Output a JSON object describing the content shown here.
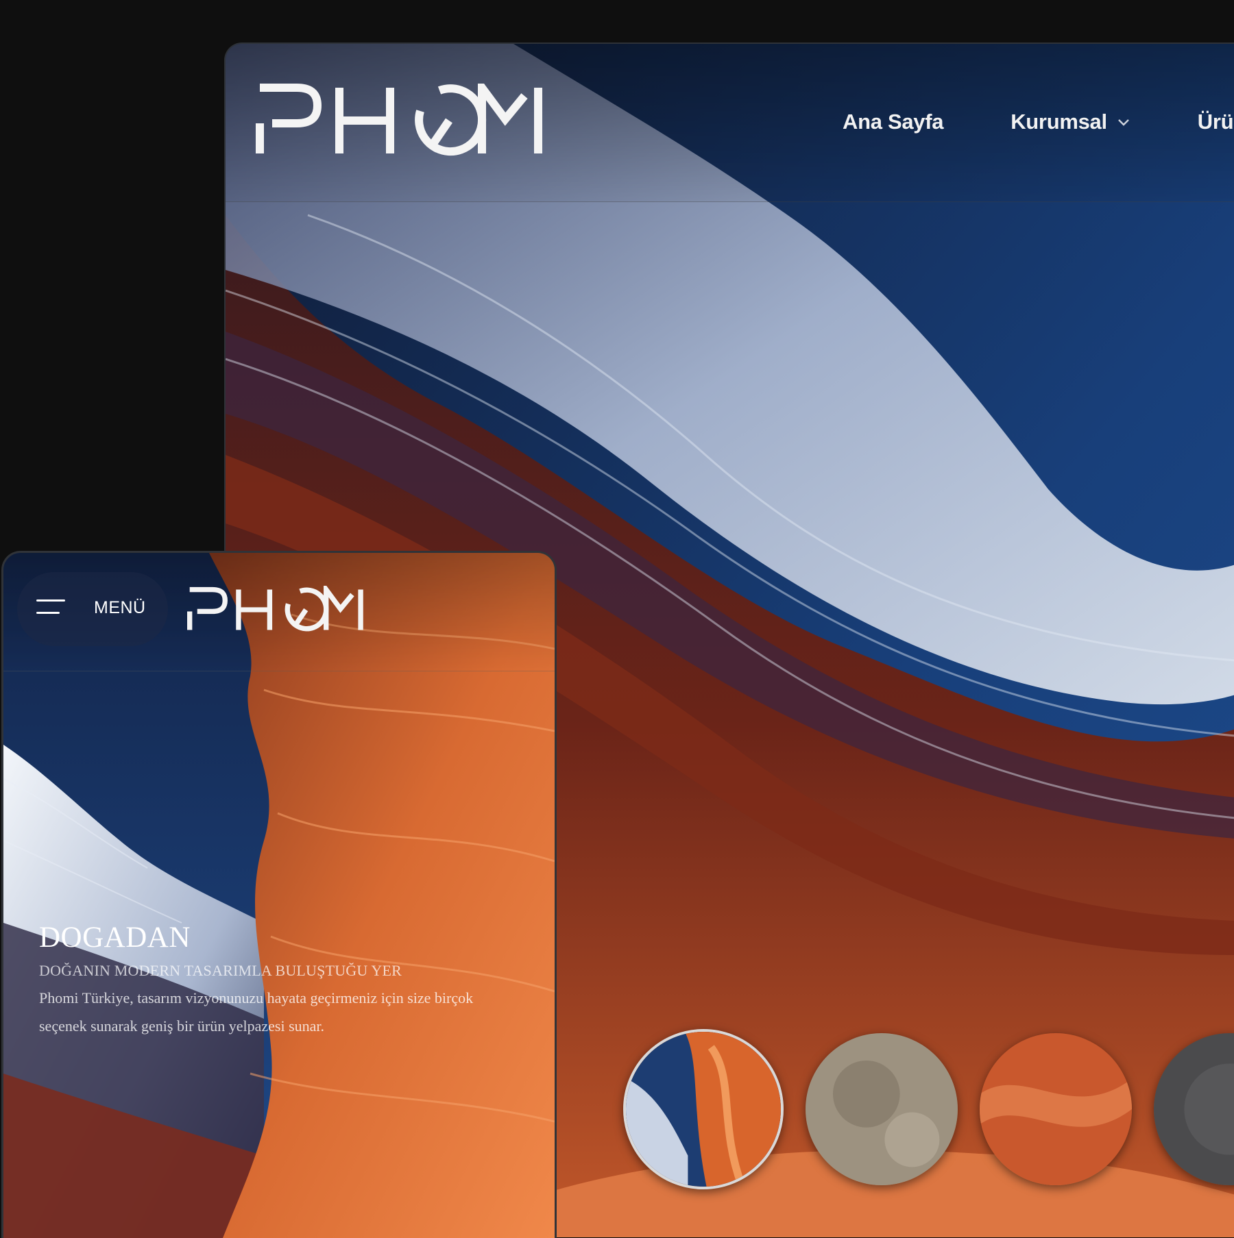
{
  "brand": {
    "logo_text": "PHOMI"
  },
  "desktop": {
    "nav": [
      {
        "label": "Ana Sayfa",
        "has_dropdown": false
      },
      {
        "label": "Kurumsal",
        "has_dropdown": true
      },
      {
        "label": "Ürünle",
        "has_dropdown": false
      }
    ],
    "swatches": [
      {
        "name": "canyon",
        "active": true
      },
      {
        "name": "beige-stone",
        "active": false
      },
      {
        "name": "orange-sandstone",
        "active": false
      },
      {
        "name": "grey-stone",
        "active": false
      }
    ]
  },
  "mobile": {
    "menu_label": "MENÜ",
    "hero": {
      "title": "DOGADAN",
      "subtitle": "DOĞANIN MODERN TASARIMLA BULUŞTUĞU YER",
      "description": "Phomi Türkiye, tasarım vizyonunuzu hayata geçirmeniz için size birçok seçenek sunarak geniş bir ürün yelpazesi sunar."
    }
  },
  "colors": {
    "page_background": "#0f0f0f",
    "deep_blue": "#16305e",
    "canyon_orange": "#d2602a",
    "rock_white": "#dfe6f0"
  }
}
